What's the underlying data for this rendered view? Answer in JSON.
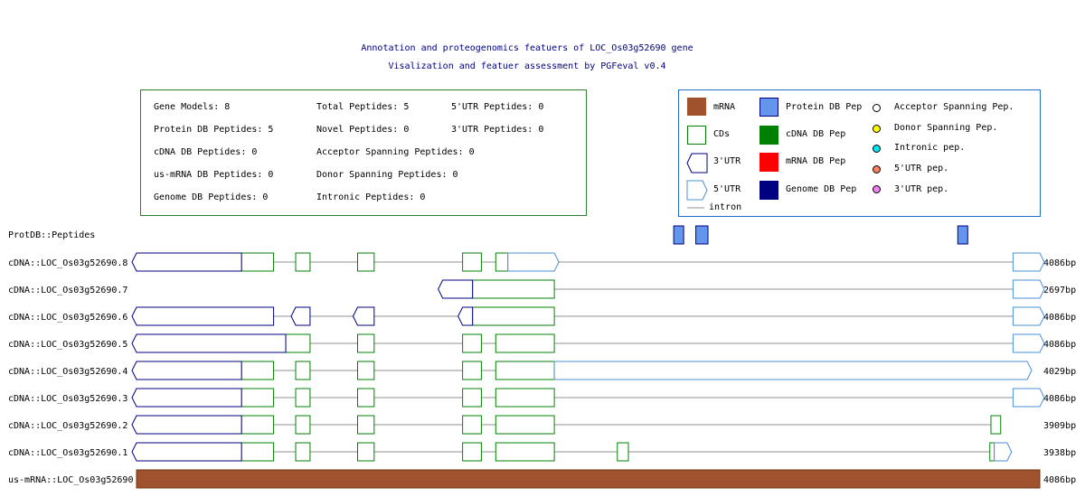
{
  "header": {
    "title_line1": "Annotation and proteogenomics featuers of LOC_Os03g52690 gene",
    "title_line2": "Visalization and featuer assessment by PGFeval v0.4"
  },
  "stats": {
    "gene_models": "Gene Models: 8",
    "total_peptides": "Total Peptides: 5",
    "utr5_peptides": "5'UTR Peptides: 0",
    "protein_db_peptides": "Protein DB Peptides: 5",
    "novel_peptides": "Novel Peptides: 0",
    "utr3_peptides": "3'UTR Peptides: 0",
    "cdna_db_peptides": "cDNA DB Peptides: 0",
    "acceptor_spanning": "Acceptor Spanning Peptides: 0",
    "usmrna_db_peptides": "us-mRNA DB Peptides: 0",
    "donor_spanning": "Donor Spanning Peptides: 0",
    "genome_db_peptides": "Genome DB Peptides: 0",
    "intronic_peptides": "Intronic Peptides: 0"
  },
  "legend": {
    "mrna": "mRNA",
    "cds": "CDs",
    "utr3": "3'UTR",
    "utr5": "5'UTR",
    "intron": "intron",
    "protein_db_pep": "Protein DB Pep",
    "cdna_db_pep": "cDNA DB Pep",
    "mrna_db_pep": "mRNA DB Pep",
    "genome_db_pep": "Genome DB Pep",
    "acceptor_pep": "Acceptor Spanning Pep.",
    "donor_pep": "Donor Spanning Pep.",
    "intronic_pep": "Intronic pep.",
    "utr5_pep": "5'UTR pep.",
    "utr3_pep": "3'UTR pep.",
    "colors": {
      "mrna": "#a0522d",
      "cds": "#008000",
      "utr": "#000080",
      "utr5": "#4a90d9",
      "intron": "#c8c8c8",
      "protein_db": "#6495ed",
      "cdna_db": "#008000",
      "mrna_db": "#ff0000",
      "genome_db": "#000080",
      "acceptor": "#ffffff",
      "donor": "#ffff00",
      "intronic": "#00e5ee",
      "utr5_pep": "#fa8060",
      "utr3_pep": "#ee82ee"
    }
  },
  "chart_data": {
    "type": "gene_structure",
    "gene": "LOC_Os03g52690",
    "genomic_span_bp": 4086,
    "peptides_track": {
      "label": "ProtDB::Peptides",
      "peptides": [
        [
          2430,
          2475
        ],
        [
          2530,
          2585
        ],
        [
          3715,
          3760
        ]
      ]
    },
    "transcripts": [
      {
        "label": "cDNA::LOC_Os03g52690.8",
        "length": "4086bp",
        "utr3": [
          [
            0,
            475
          ]
        ],
        "cds": [
          [
            475,
            620
          ],
          [
            720,
            785
          ],
          [
            1000,
            1075
          ],
          [
            1475,
            1560
          ],
          [
            1625,
            1680
          ]
        ],
        "utr5": [
          [
            1680,
            1890
          ],
          [
            3965,
            4086
          ]
        ],
        "intron_span": [
          0,
          4086
        ]
      },
      {
        "label": "cDNA::LOC_Os03g52690.7",
        "length": "2697bp",
        "utr3": [
          [
            1385,
            1520
          ]
        ],
        "cds": [
          [
            1520,
            1890
          ]
        ],
        "utr5": [
          [
            3965,
            4086
          ]
        ],
        "intron_span": [
          1385,
          4086
        ]
      },
      {
        "label": "cDNA::LOC_Os03g52690.6",
        "length": "4086bp",
        "utr3": [
          [
            0,
            620
          ],
          [
            720,
            785
          ],
          [
            1000,
            1075
          ],
          [
            1475,
            1520
          ]
        ],
        "cds": [
          [
            1520,
            1890
          ]
        ],
        "utr5": [
          [
            3965,
            4086
          ]
        ],
        "intron_span": [
          0,
          4086
        ]
      },
      {
        "label": "cDNA::LOC_Os03g52690.5",
        "length": "4086bp",
        "utr3": [
          [
            0,
            675
          ]
        ],
        "cds": [
          [
            675,
            785
          ],
          [
            1000,
            1075
          ],
          [
            1475,
            1560
          ],
          [
            1625,
            1890
          ]
        ],
        "utr5": [
          [
            3965,
            4086
          ]
        ],
        "intron_span": [
          0,
          4086
        ]
      },
      {
        "label": "cDNA::LOC_Os03g52690.4",
        "length": "4029bp",
        "utr3": [
          [
            0,
            475
          ]
        ],
        "cds": [
          [
            475,
            620
          ],
          [
            720,
            785
          ],
          [
            1000,
            1075
          ],
          [
            1475,
            1560
          ],
          [
            1625,
            1890
          ]
        ],
        "utr5": [
          [
            1890,
            4029
          ]
        ],
        "intron_span": [
          0,
          4029
        ]
      },
      {
        "label": "cDNA::LOC_Os03g52690.3",
        "length": "4086bp",
        "utr3": [
          [
            0,
            475
          ]
        ],
        "cds": [
          [
            475,
            620
          ],
          [
            720,
            785
          ],
          [
            1000,
            1075
          ],
          [
            1475,
            1560
          ],
          [
            1625,
            1890
          ]
        ],
        "utr5": [
          [
            3965,
            4086
          ]
        ],
        "intron_span": [
          0,
          4086
        ]
      },
      {
        "label": "cDNA::LOC_Os03g52690.2",
        "length": "3909bp",
        "utr3": [
          [
            0,
            475
          ]
        ],
        "cds": [
          [
            475,
            620
          ],
          [
            720,
            785
          ],
          [
            1000,
            1075
          ],
          [
            1475,
            1560
          ],
          [
            1625,
            1890
          ],
          [
            3865,
            3909
          ]
        ],
        "utr5": [],
        "intron_span": [
          0,
          3909
        ]
      },
      {
        "label": "cDNA::LOC_Os03g52690.1",
        "length": "3938bp",
        "utr3": [
          [
            0,
            475
          ]
        ],
        "cds": [
          [
            475,
            620
          ],
          [
            720,
            785
          ],
          [
            1000,
            1075
          ],
          [
            1475,
            1560
          ],
          [
            1625,
            1890
          ],
          [
            2175,
            2225
          ],
          [
            3860,
            3880
          ]
        ],
        "utr5": [
          [
            3880,
            3938
          ]
        ],
        "intron_span": [
          0,
          3938
        ]
      },
      {
        "label": "us-mRNA::LOC_Os03g52690",
        "length": "4086bp",
        "mrna": [
          [
            0,
            4086
          ]
        ]
      }
    ]
  }
}
